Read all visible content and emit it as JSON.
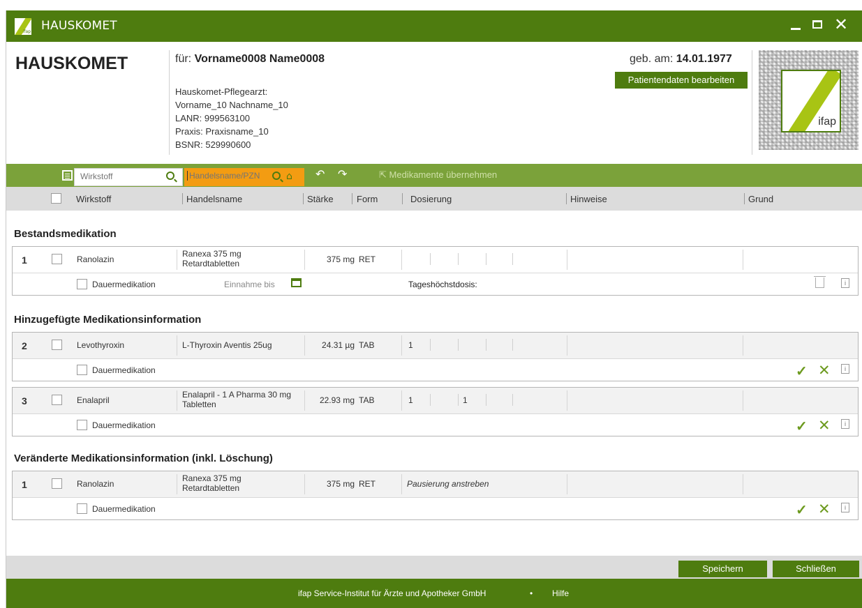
{
  "window": {
    "title": "HAUSKOMET",
    "logo_text": "ifap"
  },
  "header": {
    "app_name": "HAUSKOMET",
    "patient_prefix": "für:",
    "patient_name": "Vorname0008 Name0008",
    "doctor_title": "Hauskomet-Pflegearzt:",
    "doctor_name": "Vorname_10 Nachname_10",
    "lanr": "LANR: 999563100",
    "praxis": "Praxis: Praxisname_10",
    "bsnr": "BSNR: 529990600",
    "dob_label": "geb. am:",
    "dob_value": "14.01.1977",
    "edit_button": "Patientendaten bearbeiten",
    "qr_logo_text": "ifap"
  },
  "toolbar": {
    "wirkstoff_placeholder": "Wirkstoff",
    "handel_placeholder": "Handelsname/PZN",
    "takeover_label": "Medikamente übernehmen"
  },
  "columns": {
    "wirkstoff": "Wirkstoff",
    "handelsname": "Handelsname",
    "staerke": "Stärke",
    "form": "Form",
    "dosierung": "Dosierung",
    "hinweise": "Hinweise",
    "grund": "Grund"
  },
  "sections": {
    "bestand": "Bestandsmedikation",
    "hinzu": "Hinzugefügte Medikationsinformation",
    "veraendert": "Veränderte Medikationsinformation (inkl. Löschung)"
  },
  "meds": [
    {
      "num": "1",
      "wirkstoff": "Ranolazin",
      "handel": "Ranexa 375 mg Retardtabletten",
      "staerke": "375 mg",
      "form": "RET",
      "dos": [
        "",
        "",
        "",
        ""
      ],
      "dauer": "Dauermedikation",
      "einnahme": "Einnahme bis",
      "thd": "Tageshöchstdosis:"
    },
    {
      "num": "2",
      "wirkstoff": "Levothyroxin",
      "handel": "L-Thyroxin Aventis 25ug",
      "staerke": "24.31 µg",
      "form": "TAB",
      "dos": [
        "1",
        "",
        "",
        ""
      ],
      "dauer": "Dauermedikation"
    },
    {
      "num": "3",
      "wirkstoff": "Enalapril",
      "handel": "Enalapril - 1 A Pharma 30 mg Tabletten",
      "staerke": "22.93 mg",
      "form": "TAB",
      "dos": [
        "1",
        "",
        "1",
        ""
      ],
      "dauer": "Dauermedikation"
    },
    {
      "num": "1",
      "wirkstoff": "Ranolazin",
      "handel": "Ranexa 375 mg Retardtabletten",
      "staerke": "375 mg",
      "form": "RET",
      "dos_text": "Pausierung anstreben",
      "dauer": "Dauermedikation"
    }
  ],
  "footer": {
    "save": "Speichern",
    "close": "Schließen",
    "company": "ifap Service-Institut für Ärzte und Apotheker GmbH",
    "dot": "•",
    "help": "Hilfe"
  },
  "colors": {
    "brand_green": "#4e7c0f",
    "toolbar_green": "#7ba23a",
    "search_orange": "#f39c12"
  }
}
